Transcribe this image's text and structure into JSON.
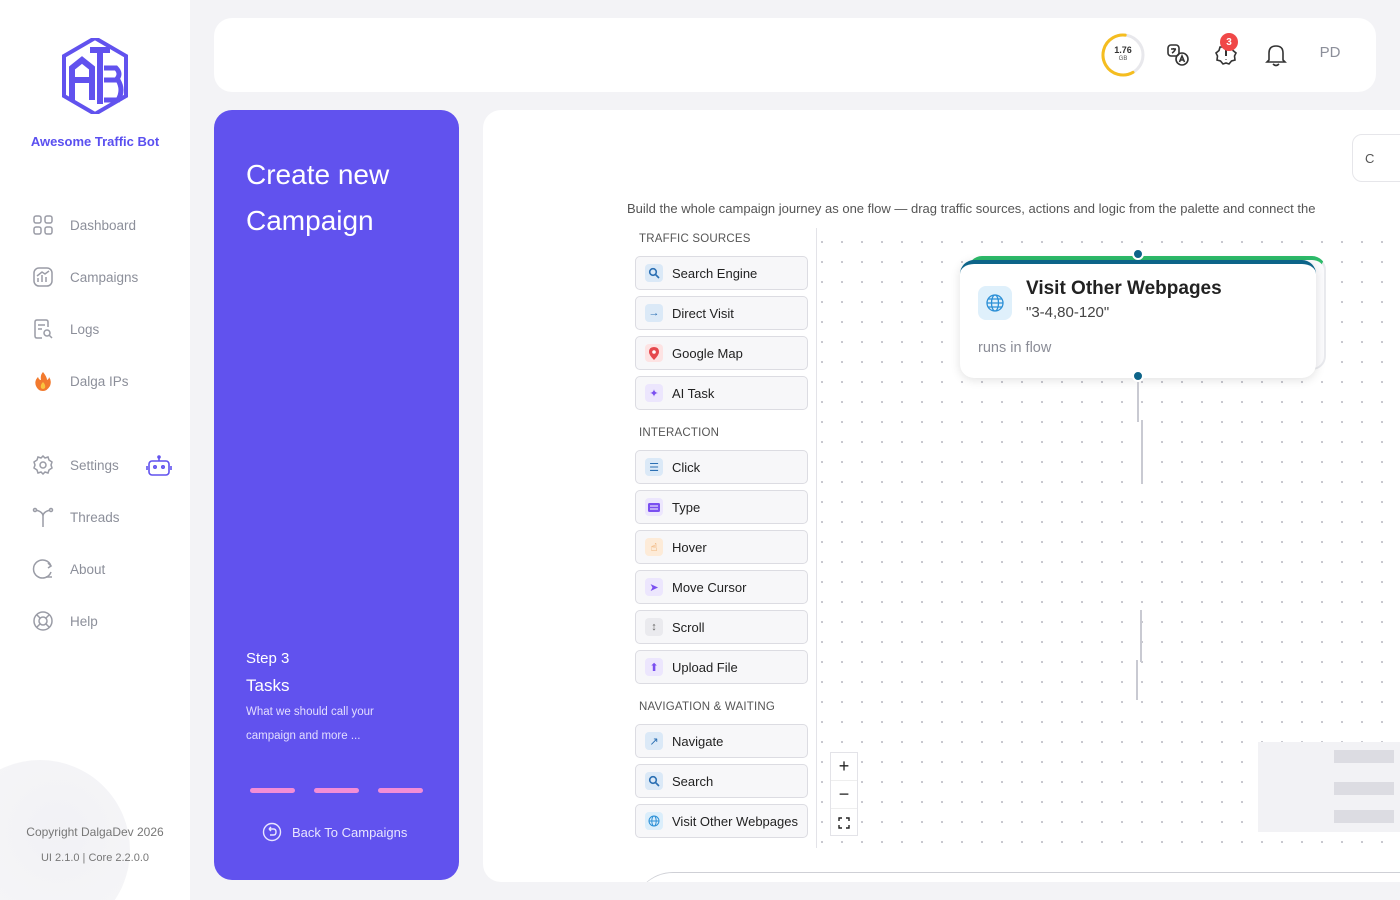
{
  "sidebar": {
    "brand": "Awesome Traffic Bot",
    "items": [
      {
        "label": "Dashboard",
        "icon": "grid-icon"
      },
      {
        "label": "Campaigns",
        "icon": "chart-icon"
      },
      {
        "label": "Logs",
        "icon": "log-icon"
      },
      {
        "label": "Dalga IPs",
        "icon": "fire-icon"
      },
      {
        "label": "Settings",
        "icon": "gear-icon"
      },
      {
        "label": "Threads",
        "icon": "fork-icon"
      },
      {
        "label": "About",
        "icon": "about-icon"
      },
      {
        "label": "Help",
        "icon": "lifebuoy-icon"
      }
    ],
    "copyright": "Copyright DalgaDev 2026",
    "version": "UI 2.1.0 | Core 2.2.0.0"
  },
  "header": {
    "usage_value": "1.76",
    "usage_unit": "GB",
    "usage_fraction": 0.6,
    "alert_count": "3",
    "avatar_initials": "PD"
  },
  "step_panel": {
    "title": "Create new Campaign",
    "step_number": "Step 3",
    "step_name": "Tasks",
    "step_description": "What we should call your campaign and more ...",
    "back_label": "Back To Campaigns"
  },
  "main": {
    "corner_button": "C",
    "instructions": "Build the whole campaign journey as one flow — drag traffic sources, actions and logic from the palette and connect the",
    "palette": {
      "traffic_heading": "TRAFFIC SOURCES",
      "traffic": [
        "Search Engine",
        "Direct Visit",
        "Google Map",
        "AI Task"
      ],
      "interaction_heading": "INTERACTION",
      "interaction": [
        "Click",
        "Type",
        "Hover",
        "Move Cursor",
        "Scroll",
        "Upload File"
      ],
      "navigation_heading": "NAVIGATION & WAITING",
      "navigation": [
        "Navigate",
        "Search",
        "Visit Other Webpages"
      ]
    },
    "node": {
      "title": "Visit Other Webpages",
      "subtitle": "\"3-4,80-120\"",
      "footer": "runs in flow"
    },
    "zoom": {
      "in": "+",
      "out": "−"
    }
  },
  "colors": {
    "accent": "#6152ee",
    "brand_text": "#5a4ff0",
    "node_border": "#0d6489",
    "badge": "#f04848",
    "progress_dash": "#f38dd6"
  }
}
